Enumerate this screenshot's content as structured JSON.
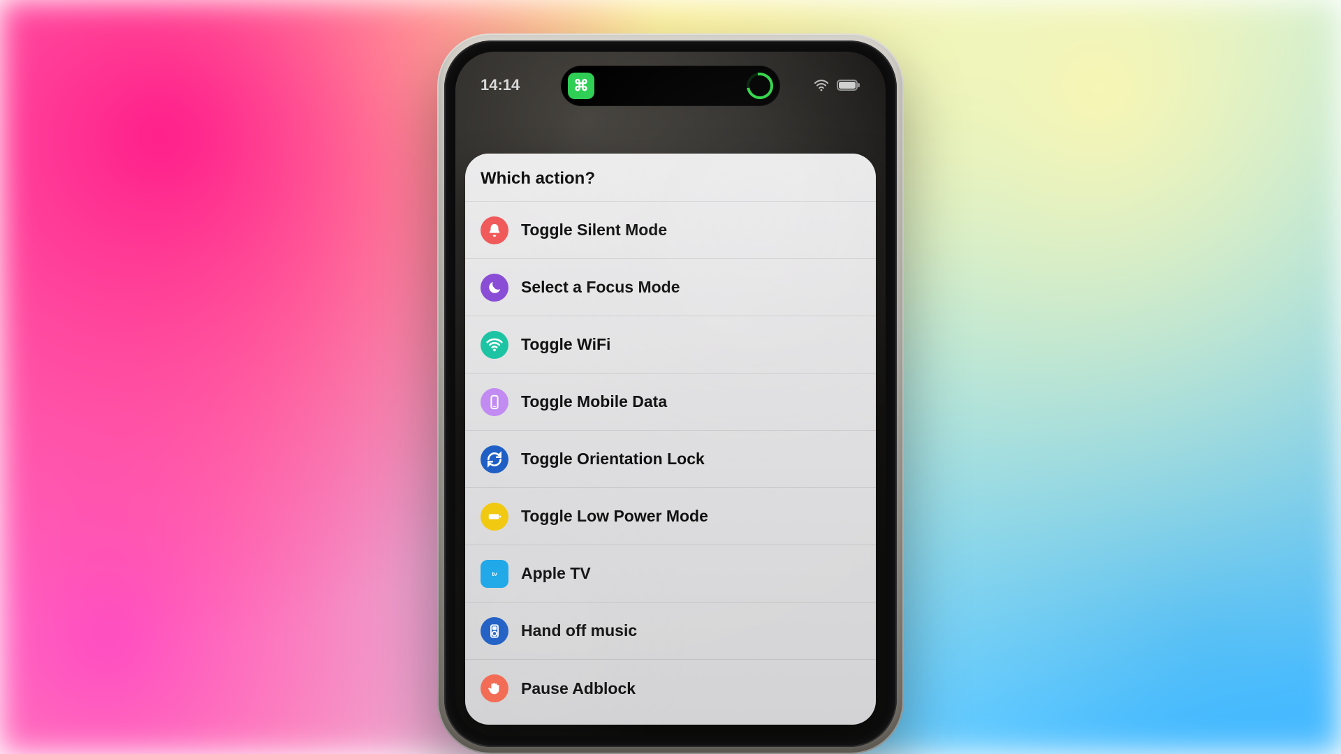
{
  "status": {
    "time": "14:14",
    "island_app": "⌘"
  },
  "sheet": {
    "title": "Which action?",
    "items": [
      {
        "id": "toggle-silent",
        "label": "Toggle Silent Mode",
        "icon": "bell",
        "color": "#f05a5a",
        "shape": "circle"
      },
      {
        "id": "select-focus",
        "label": "Select a Focus Mode",
        "icon": "moon",
        "color": "#8a4dd6",
        "shape": "circle"
      },
      {
        "id": "toggle-wifi",
        "label": "Toggle WiFi",
        "icon": "wifi",
        "color": "#1dc4a4",
        "shape": "circle"
      },
      {
        "id": "toggle-mobile-data",
        "label": "Toggle Mobile Data",
        "icon": "phone",
        "color": "#c18bf2",
        "shape": "circle"
      },
      {
        "id": "toggle-orientation",
        "label": "Toggle Orientation Lock",
        "icon": "sync",
        "color": "#1f5fc5",
        "shape": "circle"
      },
      {
        "id": "toggle-low-power",
        "label": "Toggle Low Power Mode",
        "icon": "battery",
        "color": "#f2c90f",
        "shape": "circle"
      },
      {
        "id": "apple-tv",
        "label": "Apple TV",
        "icon": "appletv",
        "color": "#1da7e8",
        "shape": "square"
      },
      {
        "id": "handoff-music",
        "label": "Hand off music",
        "icon": "ipod",
        "color": "#1f5fc5",
        "shape": "circle"
      },
      {
        "id": "pause-adblock",
        "label": "Pause Adblock",
        "icon": "hand",
        "color": "#f36a52",
        "shape": "circle"
      }
    ]
  }
}
